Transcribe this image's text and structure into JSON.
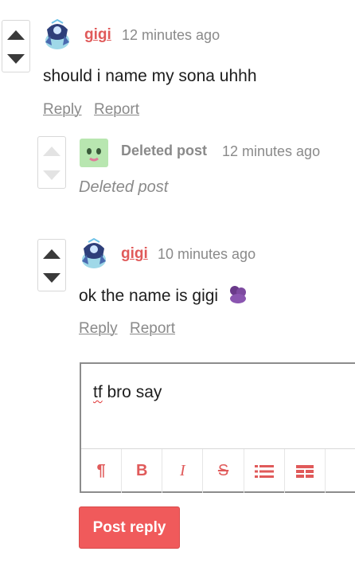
{
  "comments": [
    {
      "author": "gigi",
      "time": "12 minutes ago",
      "body": "should i name my sona uhhh",
      "reply_label": "Reply",
      "report_label": "Report"
    },
    {
      "author": "Deleted post",
      "time": "12 minutes ago",
      "body": "Deleted post"
    },
    {
      "author": "gigi",
      "time": "10 minutes ago",
      "body": "ok the name is gigi",
      "reply_label": "Reply",
      "report_label": "Report"
    }
  ],
  "editor": {
    "text_misspelled": "tf",
    "text_rest": " bro say",
    "toolbar": [
      "paragraph-icon",
      "bold-icon",
      "italic-icon",
      "strikethrough-icon",
      "list-icon",
      "table-icon"
    ],
    "toolbar_labels": {
      "paragraph": "¶",
      "bold": "B",
      "italic": "I",
      "strike": "S"
    }
  },
  "post_button_label": "Post reply",
  "colors": {
    "accent": "#f05a5b",
    "author": "#e05a5a",
    "muted": "#8a8a8a"
  }
}
